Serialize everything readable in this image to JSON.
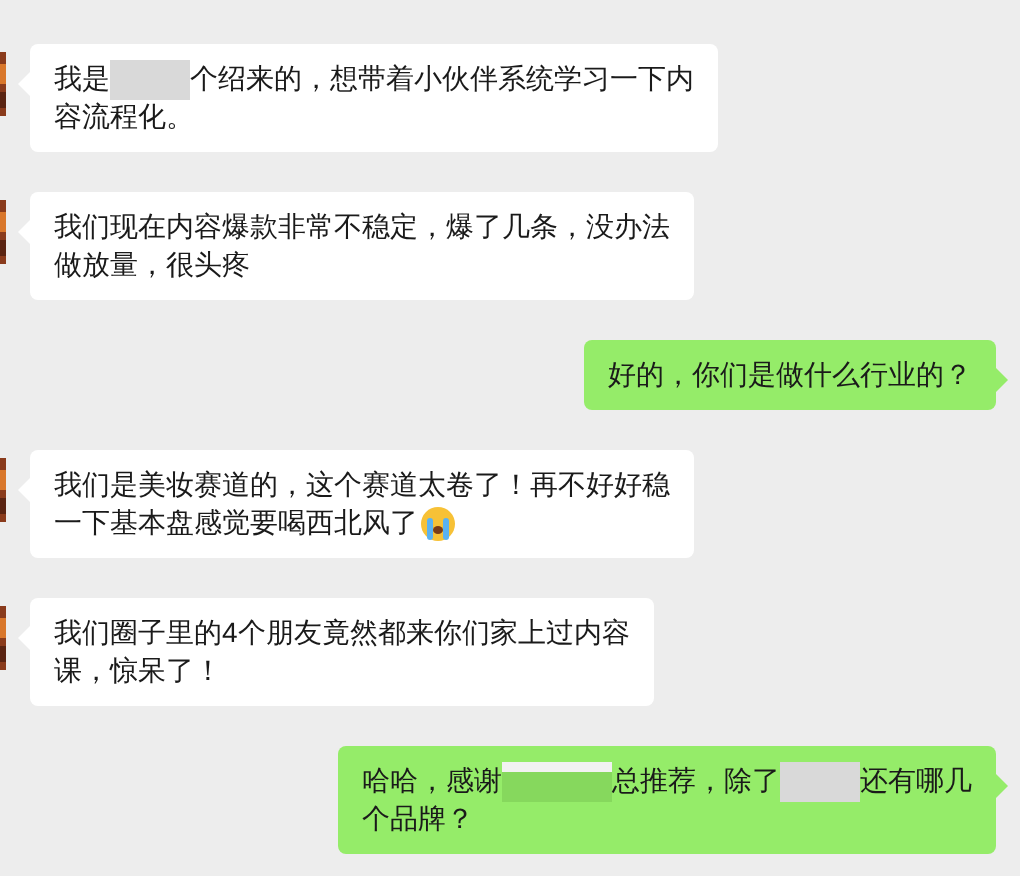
{
  "messages": [
    {
      "kind": "incoming",
      "lines": [
        [
          {
            "kind": "text",
            "text": "我是"
          },
          {
            "kind": "redacted"
          },
          {
            "kind": "text",
            "text": "个绍来的，想带着小伙伴系统学习一下内"
          }
        ],
        [
          {
            "kind": "text",
            "text": "容流程化。"
          }
        ]
      ]
    },
    {
      "kind": "incoming",
      "lines": [
        [
          {
            "kind": "text",
            "text": "我们现在内容爆款非常不稳定，爆了几条，没办法"
          }
        ],
        [
          {
            "kind": "text",
            "text": "做放量，很头疼"
          }
        ]
      ]
    },
    {
      "kind": "outgoing",
      "lines": [
        [
          {
            "kind": "text",
            "text": "好的，你们是做什么行业的？"
          }
        ]
      ]
    },
    {
      "kind": "incoming",
      "lines": [
        [
          {
            "kind": "text",
            "text": "我们是美妆赛道的，这个赛道太卷了！再不好好稳"
          }
        ],
        [
          {
            "kind": "text",
            "text": "一下基本盘感觉要喝西北风了"
          },
          {
            "kind": "emoji"
          }
        ]
      ]
    },
    {
      "kind": "incoming",
      "lines": [
        [
          {
            "kind": "text",
            "text": "我们圈子里的4个朋友竟然都来你们家上过内容"
          }
        ],
        [
          {
            "kind": "text",
            "text": "课，惊呆了！"
          }
        ]
      ]
    },
    {
      "kind": "outgoing",
      "lines": [
        [
          {
            "kind": "text",
            "text": "哈哈，感谢"
          },
          {
            "kind": "redacted"
          },
          {
            "kind": "text",
            "text": "总推荐，除了"
          },
          {
            "kind": "redacted"
          },
          {
            "kind": "text",
            "text": "还有哪几"
          }
        ],
        [
          {
            "kind": "text",
            "text": "个品牌？"
          }
        ]
      ]
    }
  ]
}
